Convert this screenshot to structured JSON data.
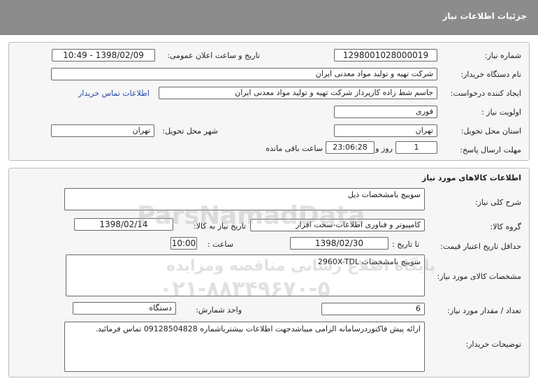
{
  "header": {
    "title": "جزئیات اطلاعات نیاز"
  },
  "info": {
    "need_number_label": "شماره نیاز:",
    "need_number": "1298001028000019",
    "announce_label": "تاریخ و ساعت اعلان عمومی:",
    "announce_value": "1398/02/09 - 10:49",
    "buyer_label": "نام دستگاه خریدار:",
    "buyer_value": "شرکت تهیه و تولید مواد معدنی ایران",
    "requester_label": "ایجاد کننده درخواست:",
    "requester_value": "جاسم شط زاده کارپرداز شرکت تهیه و تولید مواد معدنی ایران",
    "contact_link": "اطلاعات تماس خریدار",
    "priority_label": "اولویت نیاز :",
    "priority_value": "فوری",
    "province_label": "استان محل تحویل:",
    "province_value": "تهران",
    "city_label": "شهر محل تحویل:",
    "city_value": "تهران",
    "deadline_label": "مهلت ارسال پاسخ:",
    "days_value": "1",
    "days_unit": "روز و",
    "time_value": "23:06:28",
    "remaining_text": "ساعت باقی مانده"
  },
  "goods": {
    "section_title": "اطلاعات کالاهای مورد نیاز",
    "summary_label": "شرح کلی نیاز:",
    "summary_value": "سوییچ بامشخصات ذیل",
    "group_label": "گروه کالا:",
    "group_value": "کامپیوتر و فناوری اطلاعات-سخت افزار",
    "need_date_label": "تاریخ نیاز به کالا:",
    "need_date_value": "1398/02/14",
    "validity_label": "حداقل تاریخ اعتبار قیمت:",
    "until_date_label": "تا تاریخ :",
    "until_date_value": "1398/02/30",
    "hour_label": "ساعت :",
    "hour_value": "10:00",
    "specs_label": "مشخصات کالای مورد نیاز:",
    "specs_value": "سوییچ بامشخصات 2960X-TDL",
    "qty_label": "تعداد / مقدار مورد نیاز:",
    "qty_value": "6",
    "unit_label": "واحد شمارش:",
    "unit_value": "دستگاه",
    "buyer_notes_label": "توضیحات خریدار:",
    "buyer_notes_value": "ارائه پیش فاکتوردرسامانه الزامی میباشدجهت اطلاعات بیشترباشماره 09128504828 تماس فرمائید."
  },
  "watermark": {
    "brand": "ParsNamadData",
    "line1": "پایگاه اطلاع رسانی مناقصه ومزایده",
    "line2": "۰۲۱-۸۸۳۴۹۶۷۰-۵"
  },
  "colors": {
    "header_bg": "#8c8c8c",
    "link": "#2548a8",
    "panel_bg": "#f6f6f6"
  }
}
